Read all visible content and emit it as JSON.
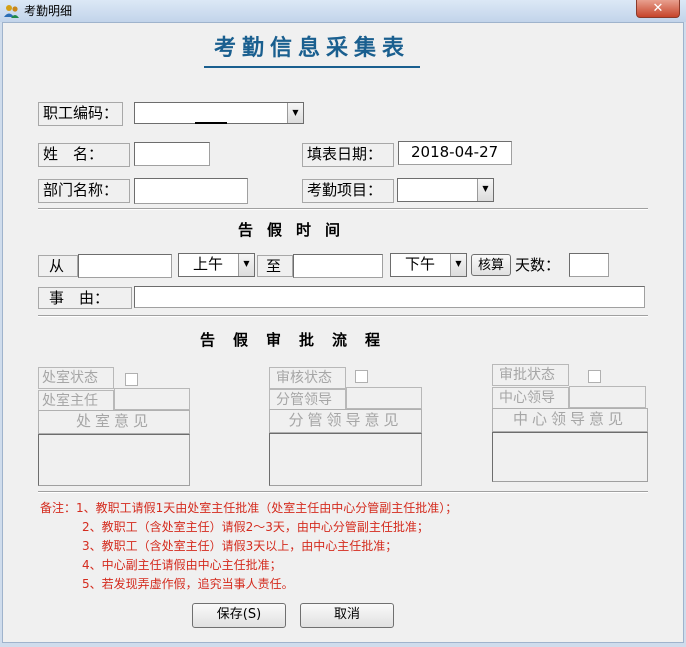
{
  "window": {
    "title": "考勤明细",
    "close_glyph": "✕"
  },
  "form": {
    "title": "考勤信息采集表",
    "employee_code": {
      "label": "职工编码：",
      "value": ""
    },
    "name": {
      "label": "姓　名：",
      "value": ""
    },
    "fill_date": {
      "label": "填表日期：",
      "value": "2018-04-27"
    },
    "department": {
      "label": "部门名称：",
      "value": ""
    },
    "attendance_item": {
      "label": "考勤项目：",
      "value": ""
    }
  },
  "leave_time": {
    "heading": "告假时间",
    "from_label": "从",
    "from_date": "",
    "from_period": "上午",
    "to_label": "至",
    "to_date": "",
    "to_period": "下午",
    "calc_button": "核算",
    "days_label": "天数：",
    "days_value": "",
    "reason_label": "事　由：",
    "reason_value": ""
  },
  "approval": {
    "heading": "告假审批流程",
    "office": {
      "status_label": "处室状态",
      "leader_label": "处室主任",
      "opinion_label": "处室意见"
    },
    "review": {
      "status_label": "审核状态",
      "leader_label": "分管领导",
      "opinion_label": "分管领导意见"
    },
    "center": {
      "status_label": "审批状态",
      "leader_label": "中心领导",
      "opinion_label": "中心领导意见"
    }
  },
  "notes": [
    "备注：1、教职工请假1天由处室主任批准（处室主任由中心分管副主任批准）；",
    "2、教职工（含处室主任）请假2～3天，由中心分管副主任批准；",
    "3、教职工（含处室主任）请假3天以上，由中心主任批准；",
    "4、中心副主任请假由中心主任批准；",
    "5、若发现弄虚作假，追究当事人责任。"
  ],
  "buttons": {
    "save": "保存(S)",
    "cancel": "取消"
  },
  "icons": {
    "app": "users-icon",
    "close": "close-icon",
    "dropdown": "chevron-down-icon"
  },
  "colors": {
    "title": "#1a5f8f",
    "note": "#d42b1e"
  }
}
